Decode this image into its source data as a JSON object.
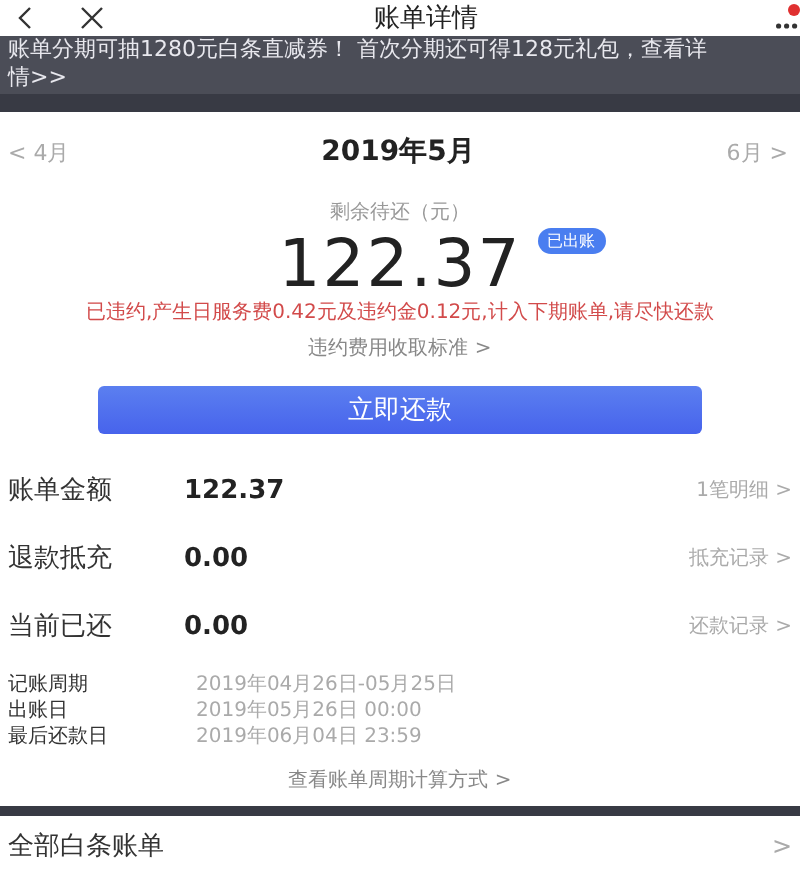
{
  "header": {
    "title": "账单详情"
  },
  "banner": {
    "text": "账单分期可抽1280元白条直减券！ 首次分期还可得128元礼包，查看详情>>"
  },
  "month_nav": {
    "prev": "< 4月",
    "current": "2019年5月",
    "next": "6月 >"
  },
  "summary": {
    "label": "剩余待还（元）",
    "amount": "122.37",
    "badge": "已出账",
    "warning": "已违约,产生日服务费0.42元及违约金0.12元,计入下期账单,请尽快还款",
    "link": "违约费用收取标准  >"
  },
  "pay_button": "立即还款",
  "rows": [
    {
      "label": "账单金额",
      "value": "122.37",
      "link": "1笔明细  >"
    },
    {
      "label": "退款抵充",
      "value": "0.00",
      "link": "抵充记录  >"
    },
    {
      "label": "当前已还",
      "value": "0.00",
      "link": "还款记录  >"
    }
  ],
  "details": [
    {
      "label": "记账周期",
      "value": "2019年04月26日-05月25日"
    },
    {
      "label": "出账日",
      "value": "2019年05月26日  00:00"
    },
    {
      "label": "最后还款日",
      "value": "2019年06月04日  23:59"
    }
  ],
  "details_link": "查看账单周期计算方式  >",
  "all_bills": {
    "label": "全部白条账单",
    "arrow": ">"
  }
}
